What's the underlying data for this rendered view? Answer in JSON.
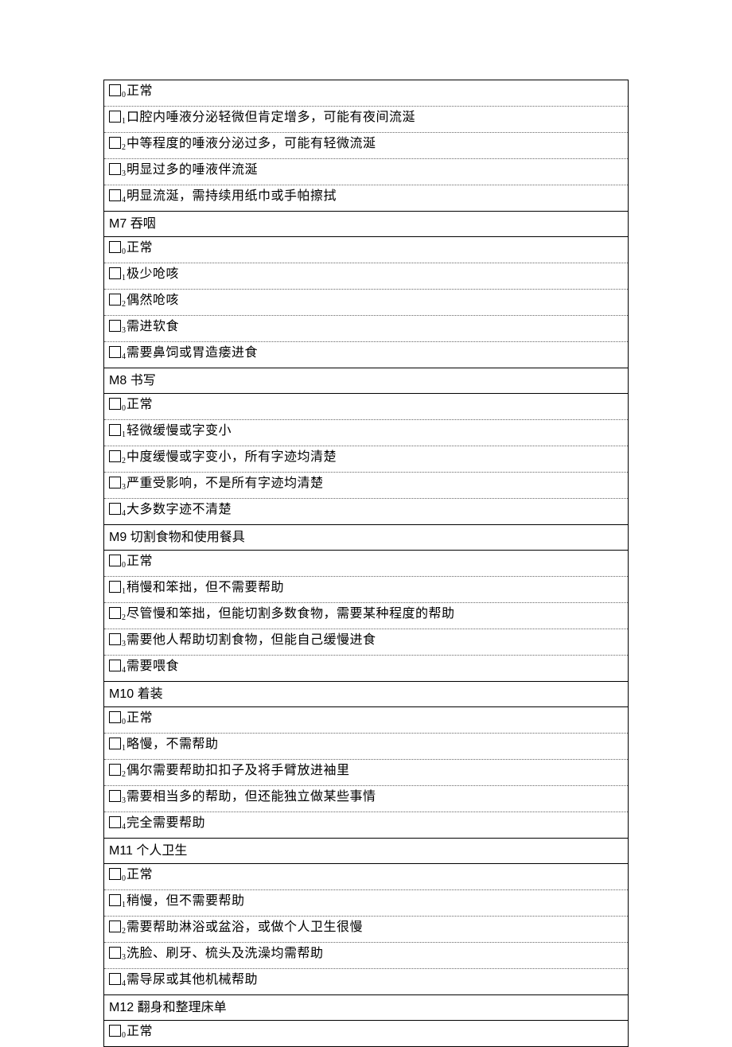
{
  "sections": [
    {
      "id": null,
      "title": null,
      "options": [
        {
          "sub": "0",
          "label": "正常"
        },
        {
          "sub": "1",
          "label": "口腔内唾液分泌轻微但肯定增多，可能有夜间流涎"
        },
        {
          "sub": "2",
          "label": "中等程度的唾液分泌过多，可能有轻微流涎"
        },
        {
          "sub": "3",
          "label": "明显过多的唾液伴流涎"
        },
        {
          "sub": "4",
          "label": "明显流涎，需持续用纸巾或手帕擦拭"
        }
      ]
    },
    {
      "id": "M7",
      "title": "吞咽",
      "options": [
        {
          "sub": "0",
          "label": "正常"
        },
        {
          "sub": "1",
          "label": "极少呛咳"
        },
        {
          "sub": "2",
          "label": "偶然呛咳"
        },
        {
          "sub": "3",
          "label": "需进软食"
        },
        {
          "sub": "4",
          "label": "需要鼻饲或胃造瘘进食"
        }
      ]
    },
    {
      "id": "M8",
      "title": "书写",
      "options": [
        {
          "sub": "0",
          "label": "正常"
        },
        {
          "sub": "1",
          "label": "轻微缓慢或字变小"
        },
        {
          "sub": "2",
          "label": "中度缓慢或字变小，所有字迹均清楚"
        },
        {
          "sub": "3",
          "label": "严重受影响，不是所有字迹均清楚"
        },
        {
          "sub": "4",
          "label": "大多数字迹不清楚"
        }
      ]
    },
    {
      "id": "M9",
      "title": "切割食物和使用餐具",
      "options": [
        {
          "sub": "0",
          "label": "正常"
        },
        {
          "sub": "1",
          "label": "稍慢和笨拙，但不需要帮助"
        },
        {
          "sub": "2",
          "label": "尽管慢和笨拙，但能切割多数食物，需要某种程度的帮助"
        },
        {
          "sub": "3",
          "label": "需要他人帮助切割食物，但能自己缓慢进食"
        },
        {
          "sub": "4",
          "label": "需要喂食"
        }
      ]
    },
    {
      "id": "M10",
      "title": "着装",
      "options": [
        {
          "sub": "0",
          "label": "正常"
        },
        {
          "sub": "1",
          "label": "略慢，不需帮助"
        },
        {
          "sub": "2",
          "label": "偶尔需要帮助扣扣子及将手臂放进袖里"
        },
        {
          "sub": "3",
          "label": "需要相当多的帮助，但还能独立做某些事情"
        },
        {
          "sub": "4",
          "label": "完全需要帮助"
        }
      ]
    },
    {
      "id": "M11",
      "title": "个人卫生",
      "options": [
        {
          "sub": "0",
          "label": "正常"
        },
        {
          "sub": "1",
          "label": "稍慢，但不需要帮助"
        },
        {
          "sub": "2",
          "label": "需要帮助淋浴或盆浴，或做个人卫生很慢"
        },
        {
          "sub": "3",
          "label": "洗脸、刷牙、梳头及洗澡均需帮助"
        },
        {
          "sub": "4",
          "label": "需导尿或其他机械帮助"
        }
      ]
    },
    {
      "id": "M12",
      "title": "翻身和整理床单",
      "options": [
        {
          "sub": "0",
          "label": "正常"
        }
      ]
    }
  ]
}
